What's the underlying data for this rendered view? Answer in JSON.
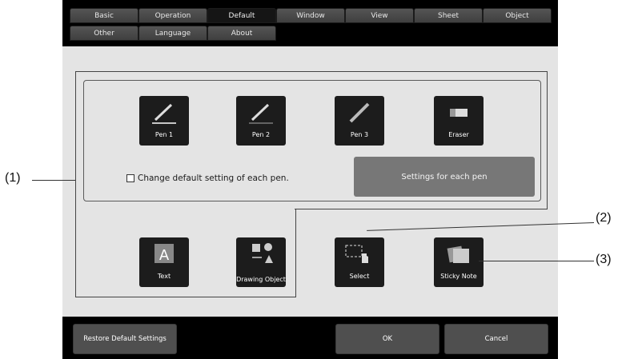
{
  "tabs": [
    "Basic",
    "Operation",
    "Default",
    "Window",
    "View",
    "Sheet",
    "Object",
    "Other",
    "Language",
    "About"
  ],
  "active_tab": "Default",
  "pens": [
    {
      "label": "Pen 1",
      "icon": "pen-icon"
    },
    {
      "label": "Pen 2",
      "icon": "pen-icon"
    },
    {
      "label": "Pen 3",
      "icon": "pen-icon"
    },
    {
      "label": "Eraser",
      "icon": "eraser-icon"
    }
  ],
  "checkbox_label": "Change default setting of each pen.",
  "settings_button": "Settings for each pen",
  "tools": [
    {
      "label": "Text",
      "icon": "text-icon"
    },
    {
      "label": "Drawing Object",
      "icon": "shapes-icon"
    },
    {
      "label": "Select",
      "icon": "select-hand-icon"
    },
    {
      "label": "Sticky Note",
      "icon": "sticky-note-icon"
    }
  ],
  "bottom": {
    "restore": "Restore Default Settings",
    "ok": "OK",
    "cancel": "Cancel"
  },
  "callouts": {
    "c1": "(1)",
    "c2": "(2)",
    "c3": "(3)"
  }
}
